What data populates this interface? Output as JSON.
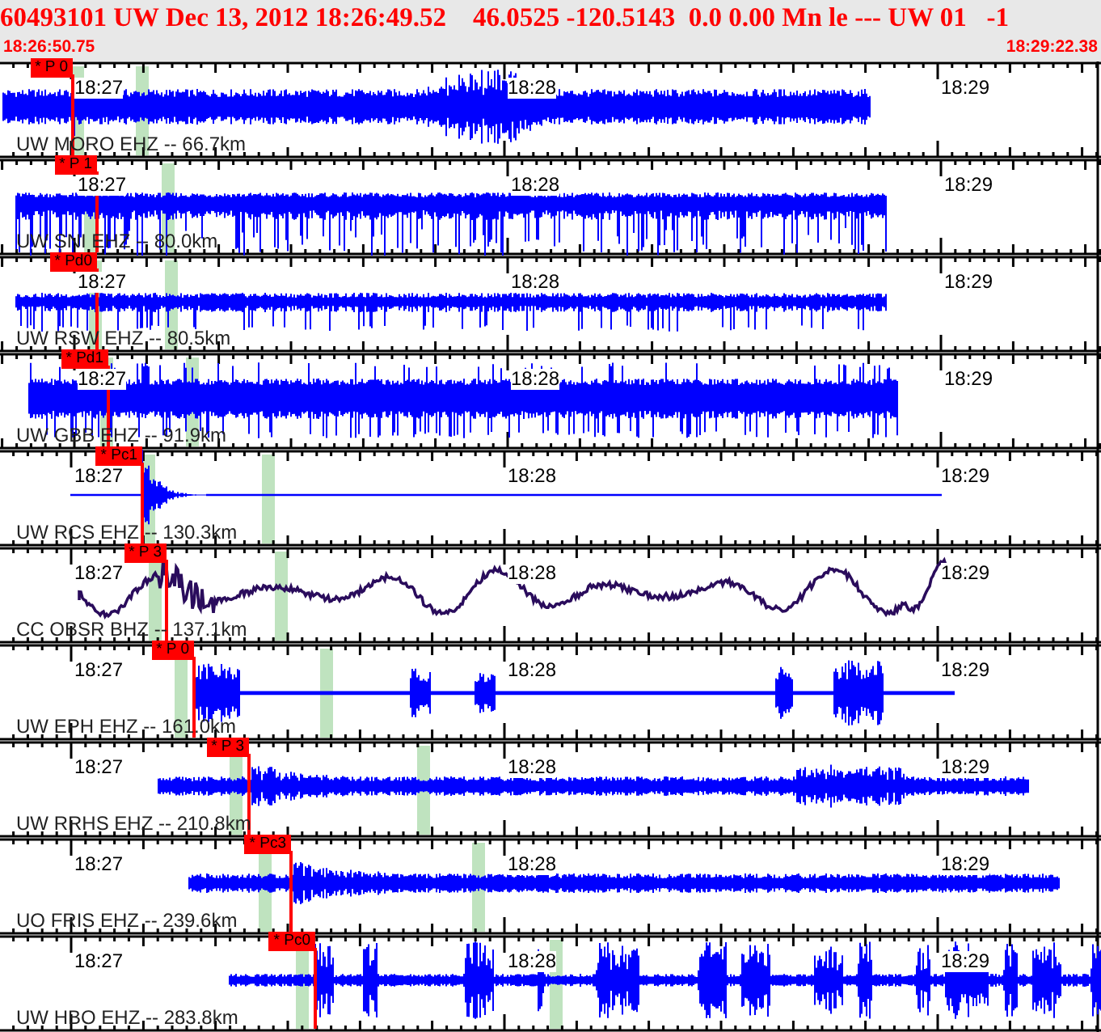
{
  "header": {
    "event_line": "60493101 UW Dec 13, 2012 18:26:49.52    46.0525 -120.5143  0.0 0.00 Mn le --- UW 01   -1",
    "start_time": "18:26:50.75",
    "end_time": "18:29:22.38"
  },
  "traces": [
    {
      "station": "UW MORO EHZ -- 66.7km",
      "pick": "* P 0",
      "kind": "emergent",
      "color": "#0000ff",
      "time_labels": [
        "18:27",
        "18:28",
        "18:29"
      ]
    },
    {
      "station": "UW SNI EHZ -- 80.0km",
      "pick": "* P 1",
      "kind": "spiky",
      "color": "#0000ff",
      "time_labels": [
        "18:27",
        "18:28",
        "18:29"
      ]
    },
    {
      "station": "UW RSW EHZ -- 80.5km",
      "pick": "* Pd0",
      "kind": "spiky",
      "color": "#0000ff",
      "time_labels": [
        "18:27",
        "18:28",
        "18:29"
      ]
    },
    {
      "station": "UW GBB EHZ -- 91.9km",
      "pick": "* Pd1",
      "kind": "dense",
      "color": "#0000ff",
      "time_labels": [
        "18:27",
        "18:28",
        "18:29"
      ]
    },
    {
      "station": "UW RCS EHZ -- 130.3km",
      "pick": "* Pc1",
      "kind": "impulse",
      "color": "#0000ff",
      "time_labels": [
        "18:27",
        "18:28",
        "18:29"
      ]
    },
    {
      "station": "CC OBSR BHZ -- 137.1km",
      "pick": "* P 3",
      "kind": "long-period",
      "color": "#2a0c5c",
      "time_labels": [
        "18:27",
        "18:28",
        "18:29"
      ]
    },
    {
      "station": "UW EPH EHZ -- 161.0km",
      "pick": "* P 0",
      "kind": "bursts",
      "color": "#0000ff",
      "time_labels": [
        "18:27",
        "18:28",
        "18:29"
      ]
    },
    {
      "station": "UW RRHS EHZ -- 210.8km",
      "pick": "* P 3",
      "kind": "noise",
      "color": "#0000ff",
      "time_labels": [
        "18:27",
        "18:28",
        "18:29"
      ]
    },
    {
      "station": "UO FRIS EHZ -- 239.6km",
      "pick": "* Pc3",
      "kind": "noise",
      "color": "#0000ff",
      "time_labels": [
        "18:27",
        "18:28",
        "18:29"
      ]
    },
    {
      "station": "UW HBO EHZ -- 283.8km",
      "pick": "* Pc0",
      "kind": "bursts2",
      "color": "#0000ff",
      "time_labels": [
        "18:27",
        "18:28",
        "18:29"
      ]
    }
  ]
}
